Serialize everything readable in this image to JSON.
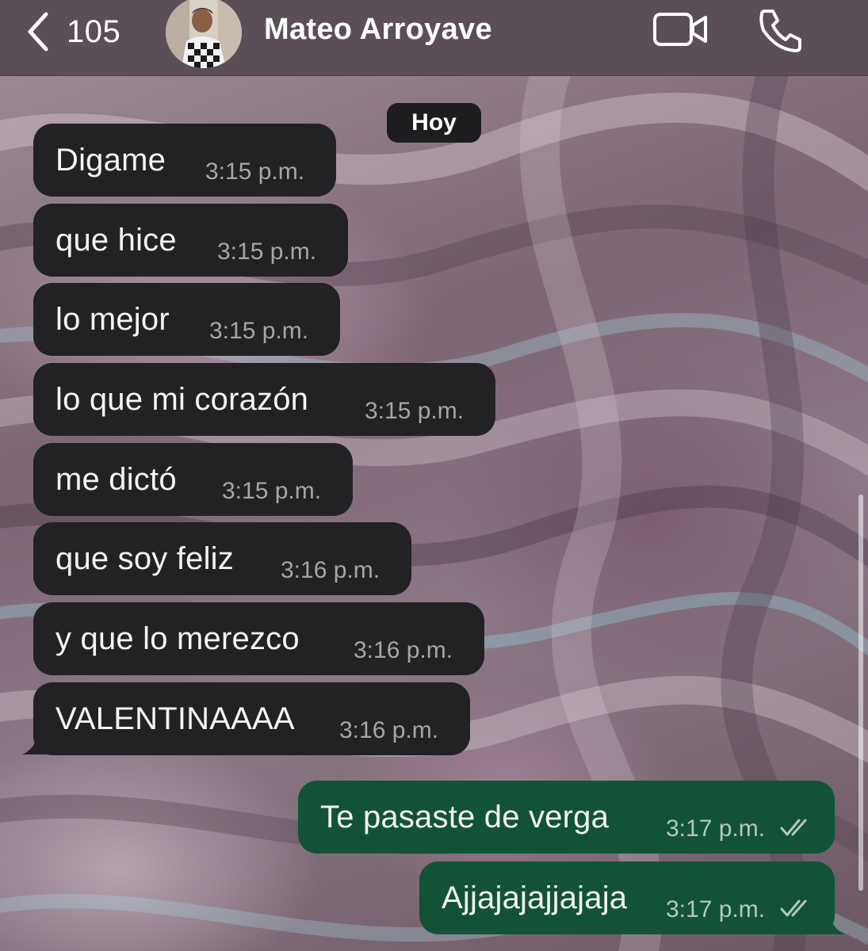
{
  "header": {
    "back_count": "105",
    "contact_name": "Mateo Arroyave",
    "back_icon": "chevron-left-icon",
    "video_icon": "video-camera-icon",
    "call_icon": "phone-icon"
  },
  "date_chip": "Hoy",
  "messages": [
    {
      "text": "Digame",
      "time": "3:15 p.m.",
      "direction": "incoming"
    },
    {
      "text": "que hice",
      "time": "3:15 p.m.",
      "direction": "incoming"
    },
    {
      "text": "lo mejor",
      "time": "3:15 p.m.",
      "direction": "incoming"
    },
    {
      "text": "lo que mi corazón",
      "time": "3:15 p.m.",
      "direction": "incoming"
    },
    {
      "text": "me dictó",
      "time": "3:15 p.m.",
      "direction": "incoming"
    },
    {
      "text": "que soy feliz",
      "time": "3:16 p.m.",
      "direction": "incoming"
    },
    {
      "text": "y que lo merezco",
      "time": "3:16 p.m.",
      "direction": "incoming"
    },
    {
      "text": "VALENTINAAAA",
      "time": "3:16 p.m.",
      "direction": "incoming"
    },
    {
      "text": "Te pasaste de verga",
      "time": "3:17 p.m.",
      "direction": "outgoing",
      "status": "read"
    },
    {
      "text": "Ajjajajajjajaja",
      "time": "3:17 p.m.",
      "direction": "outgoing",
      "status": "read"
    }
  ],
  "colors": {
    "incoming_bubble": "#222224",
    "outgoing_bubble": "#125338",
    "header_bg": "#5a4f57"
  }
}
